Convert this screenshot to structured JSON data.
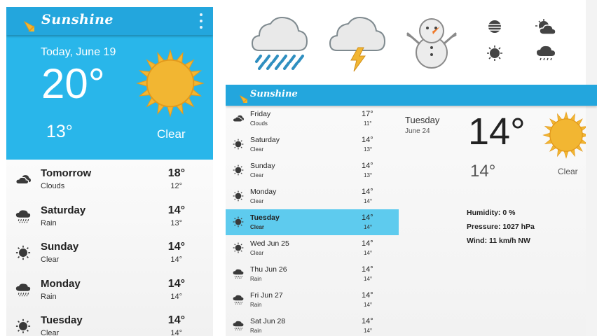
{
  "colors": {
    "primary": "#23a6dd",
    "hero": "#29b6ea",
    "selected": "#5ecbee",
    "sun": "#f2b632"
  },
  "left": {
    "app_title": "Sunshine",
    "today": {
      "date": "Today, June 19",
      "high": "20°",
      "low": "13°",
      "condition": "Clear",
      "icon": "sun-icon"
    },
    "forecast": [
      {
        "day": "Tomorrow",
        "desc": "Clouds",
        "high": "18°",
        "low": "12°",
        "icon": "clouds-icon"
      },
      {
        "day": "Saturday",
        "desc": "Rain",
        "high": "14°",
        "low": "13°",
        "icon": "rain-icon"
      },
      {
        "day": "Sunday",
        "desc": "Clear",
        "high": "14°",
        "low": "14°",
        "icon": "clear-icon"
      },
      {
        "day": "Monday",
        "desc": "Rain",
        "high": "14°",
        "low": "14°",
        "icon": "rain-icon"
      },
      {
        "day": "Tuesday",
        "desc": "Clear",
        "high": "14°",
        "low": "14°",
        "icon": "clear-icon"
      }
    ]
  },
  "showcase_icons": [
    "storm-rain-icon",
    "thunder-icon",
    "snowman-icon",
    "fog-icon",
    "partly-cloudy-icon",
    "clear-icon",
    "light-rain-icon"
  ],
  "tablet": {
    "app_title": "Sunshine",
    "forecast": [
      {
        "day": "Friday",
        "desc": "Clouds",
        "high": "17°",
        "low": "11°",
        "icon": "clouds-icon"
      },
      {
        "day": "Saturday",
        "desc": "Clear",
        "high": "14°",
        "low": "13°",
        "icon": "clear-icon"
      },
      {
        "day": "Sunday",
        "desc": "Clear",
        "high": "14°",
        "low": "13°",
        "icon": "clear-icon"
      },
      {
        "day": "Monday",
        "desc": "Clear",
        "high": "14°",
        "low": "14°",
        "icon": "clear-icon"
      },
      {
        "day": "Tuesday",
        "desc": "Clear",
        "high": "14°",
        "low": "14°",
        "icon": "clear-icon"
      },
      {
        "day": "Wed Jun 25",
        "desc": "Clear",
        "high": "14°",
        "low": "14°",
        "icon": "clear-icon"
      },
      {
        "day": "Thu Jun 26",
        "desc": "Rain",
        "high": "14°",
        "low": "14°",
        "icon": "rain-icon"
      },
      {
        "day": "Fri Jun 27",
        "desc": "Rain",
        "high": "14°",
        "low": "14°",
        "icon": "rain-icon"
      },
      {
        "day": "Sat Jun 28",
        "desc": "Rain",
        "high": "14°",
        "low": "14°",
        "icon": "rain-icon"
      }
    ],
    "selected_index": 4,
    "detail": {
      "day": "Tuesday",
      "date": "June 24",
      "high": "14°",
      "low": "14°",
      "condition": "Clear",
      "humidity": "Humidity: 0 %",
      "pressure": "Pressure: 1027 hPa",
      "wind": "Wind: 11 km/h NW"
    }
  }
}
